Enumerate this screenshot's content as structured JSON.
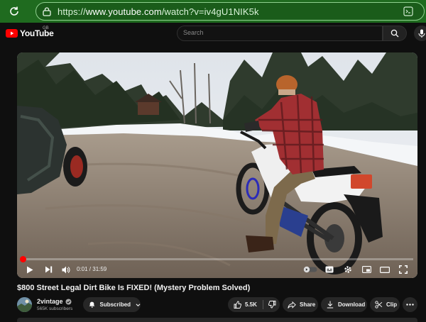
{
  "browser": {
    "url_prefix": "https://",
    "url_domain": "www.youtube.com",
    "url_path": "/watch?v=iv4gU1NIK5k"
  },
  "header": {
    "logo_text": "YouTube",
    "region": "GB",
    "search_placeholder": "Search"
  },
  "player": {
    "time_label": "0:01 / 31:59",
    "progress_fraction": 0.003
  },
  "video": {
    "title": "$800 Street Legal Dirt Bike Is FIXED! (Mystery Problem Solved)"
  },
  "channel": {
    "name": "2vintage",
    "subscribers": "565K subscribers",
    "subscribe_label": "Subscribed"
  },
  "actions": {
    "likes": "5.5K",
    "share": "Share",
    "download": "Download",
    "clip": "Clip"
  },
  "colors": {
    "browser_bar": "#1f6b1f",
    "accent": "#ff0000",
    "background": "#0f0f0f"
  }
}
